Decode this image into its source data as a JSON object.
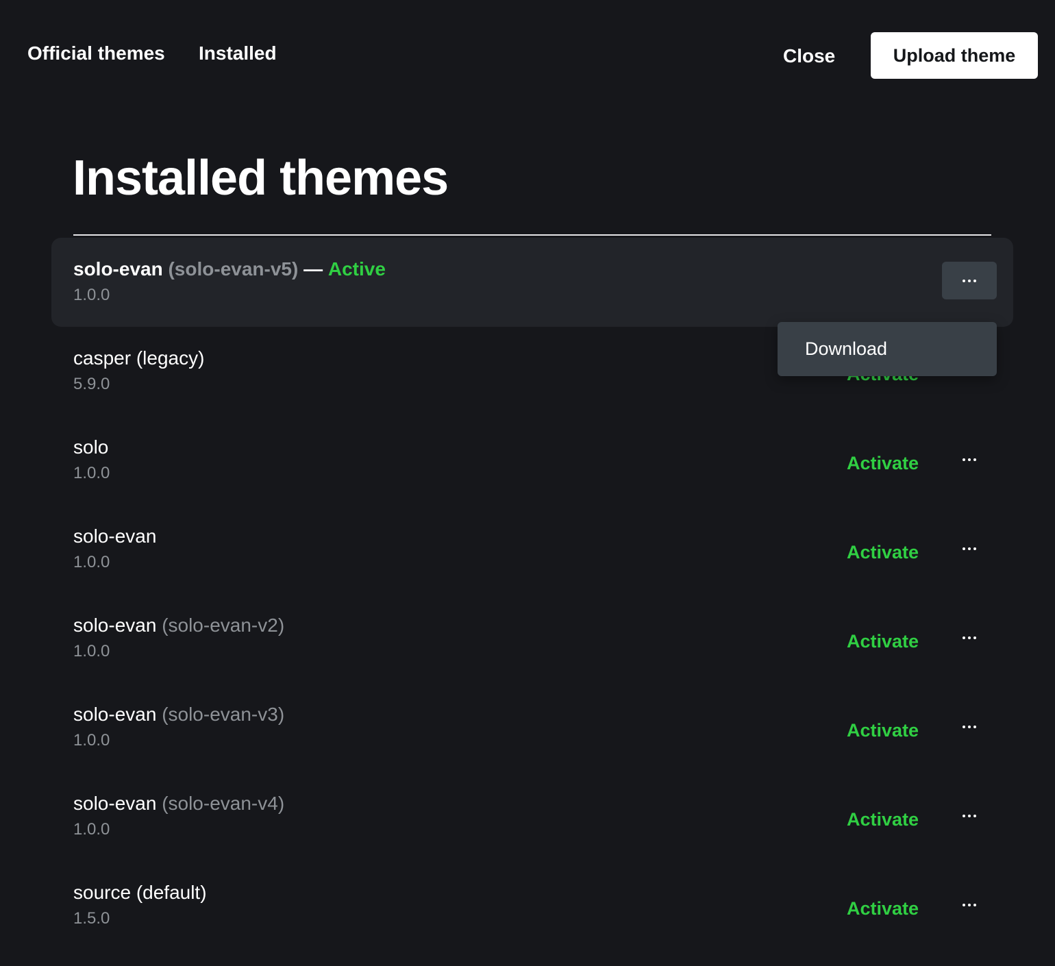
{
  "nav": {
    "tabs": [
      {
        "label": "Official themes"
      },
      {
        "label": "Installed"
      }
    ],
    "close_label": "Close",
    "upload_label": "Upload theme"
  },
  "page": {
    "title": "Installed themes"
  },
  "themes": [
    {
      "name": "solo-evan",
      "alt": "(solo-evan-v5)",
      "separator": "—",
      "status": "Active",
      "version": "1.0.0",
      "action": ""
    },
    {
      "name": "casper (legacy)",
      "alt": "",
      "separator": "",
      "status": "",
      "version": "5.9.0",
      "action": "Activate"
    },
    {
      "name": "solo",
      "alt": "",
      "separator": "",
      "status": "",
      "version": "1.0.0",
      "action": "Activate"
    },
    {
      "name": "solo-evan",
      "alt": "",
      "separator": "",
      "status": "",
      "version": "1.0.0",
      "action": "Activate"
    },
    {
      "name": "solo-evan",
      "alt": "(solo-evan-v2)",
      "separator": "",
      "status": "",
      "version": "1.0.0",
      "action": "Activate"
    },
    {
      "name": "solo-evan",
      "alt": "(solo-evan-v3)",
      "separator": "",
      "status": "",
      "version": "1.0.0",
      "action": "Activate"
    },
    {
      "name": "solo-evan",
      "alt": "(solo-evan-v4)",
      "separator": "",
      "status": "",
      "version": "1.0.0",
      "action": "Activate"
    },
    {
      "name": "source (default)",
      "alt": "",
      "separator": "",
      "status": "",
      "version": "1.5.0",
      "action": "Activate"
    }
  ],
  "dropdown": {
    "items": [
      {
        "label": "Download"
      }
    ]
  },
  "colors": {
    "background": "#16171b",
    "active_row": "#222429",
    "accent_green": "#30cf43",
    "muted_text": "#8e9297",
    "menu_bg": "#394047"
  },
  "icons": {
    "more": "ellipsis-horizontal-icon"
  }
}
